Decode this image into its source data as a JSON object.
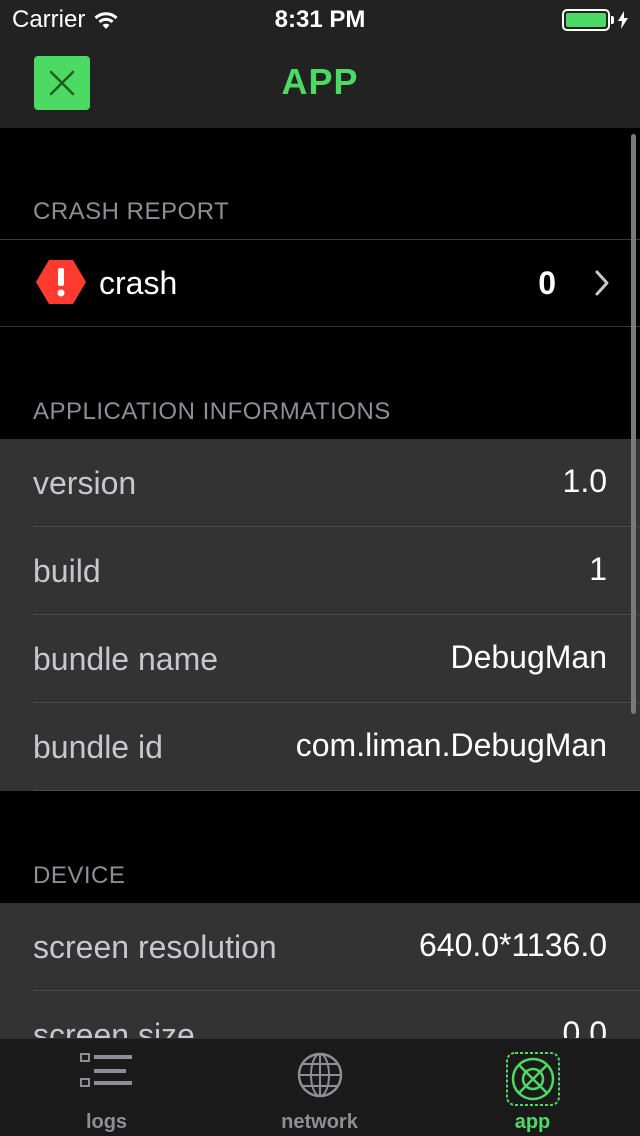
{
  "status_bar": {
    "carrier": "Carrier",
    "time": "8:31 PM",
    "battery_level": 1.0
  },
  "nav": {
    "title": "APP",
    "close_icon": "close-icon"
  },
  "crash_section": {
    "header": "CRASH REPORT",
    "label": "crash",
    "count": "0",
    "icon": "warning-octagon-icon"
  },
  "app_info": {
    "header": "APPLICATION INFORMATIONS",
    "rows": [
      {
        "key": "version",
        "value": "1.0"
      },
      {
        "key": "build",
        "value": "1"
      },
      {
        "key": "bundle name",
        "value": "DebugMan"
      },
      {
        "key": "bundle id",
        "value": "com.liman.DebugMan"
      }
    ]
  },
  "device": {
    "header": "DEVICE",
    "rows": [
      {
        "key": "screen resolution",
        "value": "640.0*1136.0"
      },
      {
        "key": "screen size",
        "value": "0.0"
      }
    ]
  },
  "tabs": [
    {
      "label": "logs",
      "icon": "list-icon",
      "active": false
    },
    {
      "label": "network",
      "icon": "globe-icon",
      "active": false
    },
    {
      "label": "app",
      "icon": "app-target-icon",
      "active": true
    }
  ],
  "colors": {
    "accent": "#4cd964",
    "crash": "#ff3b30",
    "background": "#000000",
    "cell": "#333333"
  }
}
